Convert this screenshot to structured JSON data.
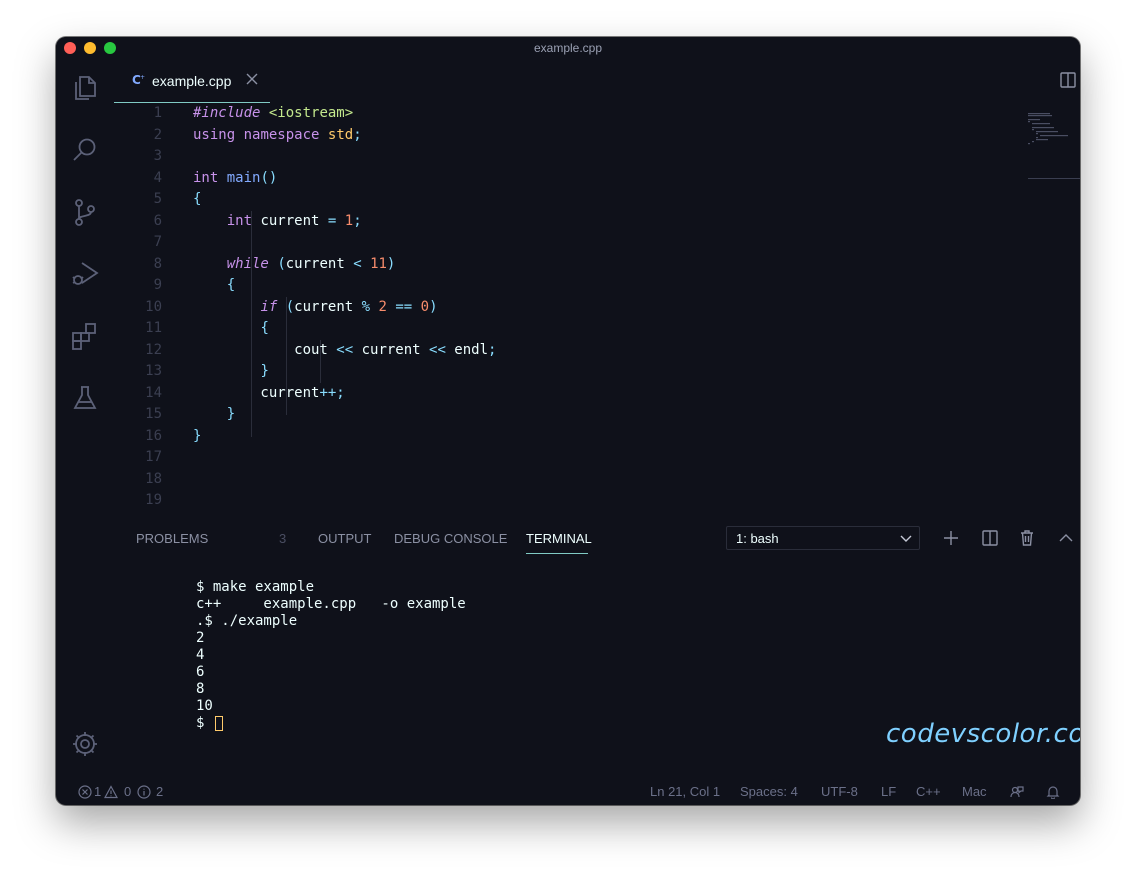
{
  "window": {
    "title": "example.cpp"
  },
  "tab": {
    "label": "example.cpp"
  },
  "editor": {
    "line_numbers": [
      "1",
      "2",
      "3",
      "4",
      "5",
      "6",
      "7",
      "8",
      "9",
      "10",
      "11",
      "12",
      "13",
      "14",
      "15",
      "16",
      "17",
      "18",
      "19"
    ],
    "lines": [
      "#include <iostream>",
      "using namespace std;",
      "",
      "int main()",
      "{",
      "    int current = 1;",
      "",
      "    while (current < 11)",
      "    {",
      "        if (current % 2 == 0)",
      "        {",
      "            cout << current << endl;",
      "        }",
      "        current++;",
      "    }",
      "}",
      "",
      "",
      ""
    ]
  },
  "panel": {
    "tabs": {
      "problems": "PROBLEMS",
      "problems_count": "3",
      "output": "OUTPUT",
      "debug_console": "DEBUG CONSOLE",
      "terminal": "TERMINAL"
    },
    "terminal_select": "1: bash",
    "terminal_lines": [
      "$ make example",
      "c++     example.cpp   -o example",
      ".$ ./example",
      "2",
      "4",
      "6",
      "8",
      "10",
      "$ "
    ],
    "watermark": "codevscolor.com"
  },
  "statusbar": {
    "errors": "1",
    "warnings": "0",
    "infos": "2",
    "position": "Ln 21, Col 1",
    "spaces": "Spaces: 4",
    "encoding": "UTF-8",
    "eol": "LF",
    "language": "C++",
    "platform": "Mac"
  },
  "colors": {
    "background": "#0f111a",
    "accent": "#80cbc4",
    "text": "#eeffff"
  },
  "icons": {
    "activity": [
      "files-icon",
      "search-icon",
      "source-control-icon",
      "run-debug-icon",
      "extensions-icon",
      "testing-icon",
      "settings-gear-icon"
    ]
  }
}
